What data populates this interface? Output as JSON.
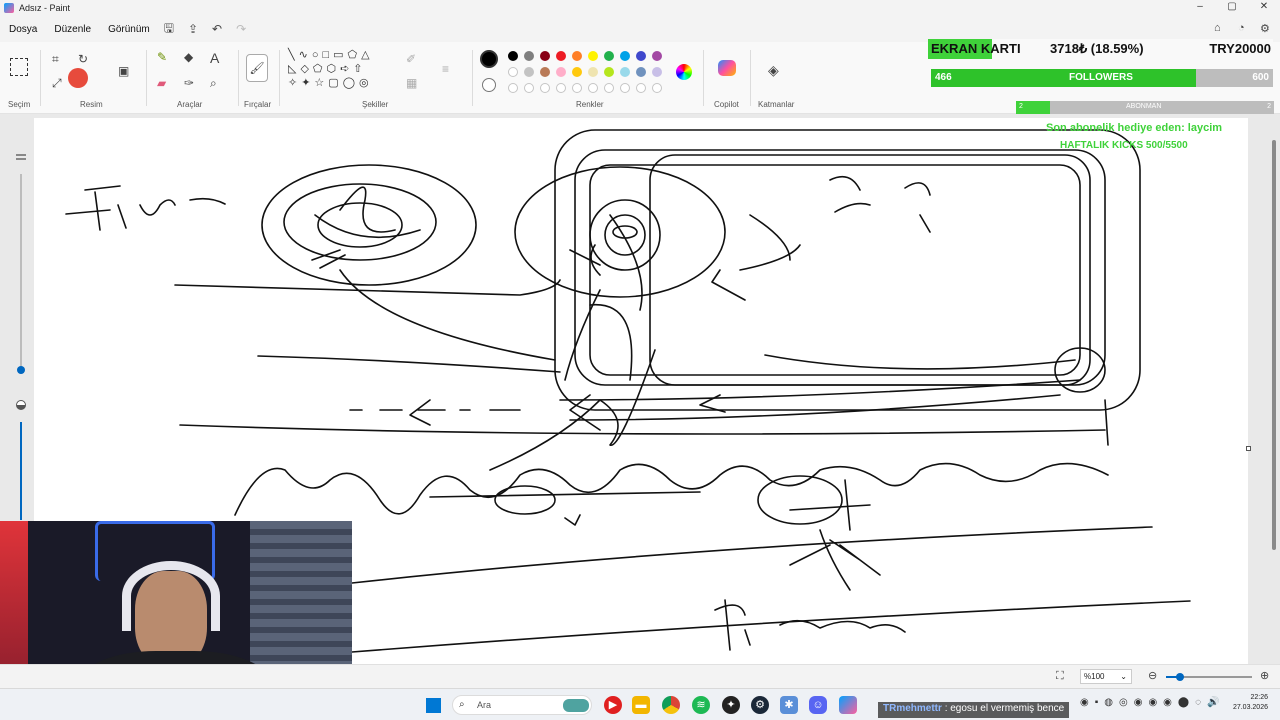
{
  "window": {
    "title": "Adsız - Paint",
    "minimize": "–",
    "maximize": "▢",
    "close": "✕"
  },
  "menu": {
    "file": "Dosya",
    "edit": "Düzenle",
    "view": "Görünüm"
  },
  "ribbon": {
    "groups": {
      "selection": "Seçim",
      "image": "Resim",
      "tools": "Araçlar",
      "brushes": "Fırçalar",
      "shapes": "Şekiller",
      "colors": "Renkler",
      "copilot": "Copilot",
      "layers": "Katmanlar"
    },
    "palette_row1": [
      "#000000",
      "#7f7f7f",
      "#880015",
      "#ed1c24",
      "#ff7f27",
      "#fff200",
      "#22b14c",
      "#00a2e8",
      "#3f48cc",
      "#a349a4"
    ],
    "palette_row2": [
      "#ffffff",
      "#c3c3c3",
      "#b97a57",
      "#ffaec9",
      "#ffc90e",
      "#efe4b0",
      "#b5e61d",
      "#99d9ea",
      "#7092be",
      "#c8bfe7"
    ]
  },
  "overlay": {
    "goal_label": "EKRAN KARTI",
    "goal_progress": "3718₺ (18.59%)",
    "goal_target": "TRY20000",
    "goal_fraction": 0.1859,
    "followers_current": "466",
    "followers_label": "FOLLOWERS",
    "followers_target": "600",
    "followers_fraction": 0.776,
    "sub_count": "2",
    "sub_label": "ABONMAN",
    "sub_last": "2",
    "gift_text": "Son abonelik hediye eden: laycim",
    "kicks_text": "HAFTALIK KICKS 500/5500"
  },
  "status": {
    "zoom": "%100"
  },
  "taskbar": {
    "search": "Ara",
    "chat_user": "TRmehmettr",
    "chat_message": ": egosu el vermemiş bence",
    "time": "22:26",
    "date": "27.03.2026"
  },
  "colors": {
    "accent": "#0067c0",
    "overlay_green": "#3fd23a",
    "canvas": "#ffffff"
  }
}
